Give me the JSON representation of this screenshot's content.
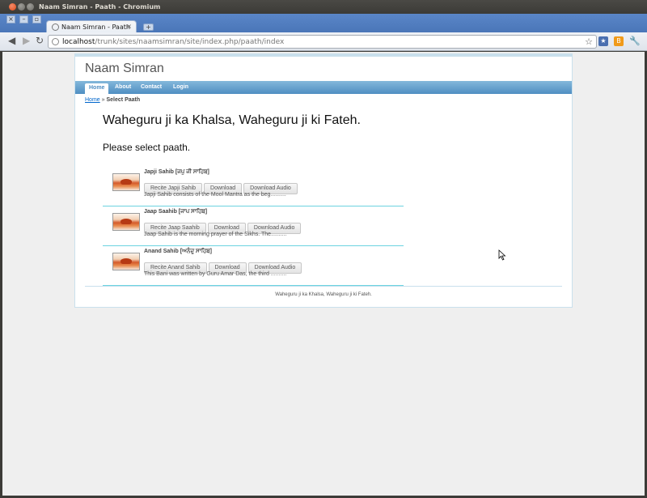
{
  "window": {
    "title": "Naam Simran - Paath - Chromium"
  },
  "tabs": [
    {
      "label": "Naam Simran - Paath",
      "close": "×"
    }
  ],
  "newtab_label": "+",
  "toolbar": {
    "url_host": "localhost",
    "url_path": "/trunk/sites/naamsimran/site/index.php/paath/index",
    "ext_icons": [
      "bookmark-star-icon",
      "blogger-icon",
      "wrench-icon"
    ]
  },
  "site": {
    "title": "Naam Simran",
    "menu": [
      "Home",
      "About",
      "Contact",
      "Login"
    ],
    "active_menu": "Home",
    "breadcrumb": {
      "home": "Home",
      "separator": "»",
      "current": "Select Paath"
    },
    "greeting": "Waheguru ji ka Khalsa, Waheguru ji ki Fateh.",
    "prompt": "Please select paath.",
    "paaths": [
      {
        "title": "Japji Sahib [ਜਪੁ ਜੀ ਸਾਹਿਬ]",
        "recite": "Recite Japji Sahib",
        "download": "Download",
        "download_audio": "Download Audio",
        "desc": "Japji Sahib consists of the Mool Mantra as the beg.........."
      },
      {
        "title": "Jaap Saahib [ਜਾਪ ਸਾਹਿਬ]",
        "recite": "Recite Jaap Saahib",
        "download": "Download",
        "download_audio": "Download Audio",
        "desc": "Jaap Sahib is the morning prayer of the Sikhs. The.........."
      },
      {
        "title": "Anand Sahib [ਅਨੰਦੁ ਸਾਹਿਬ]",
        "recite": "Recite Anand Sahib",
        "download": "Download",
        "download_audio": "Download Audio",
        "desc": "This Bani was written by Guru Amar Das, the third .........."
      }
    ],
    "footer": "Waheguru ji ka Khalsa, Waheguru ji ki Fateh."
  },
  "colors": {
    "menu": "#4f8ec2",
    "link": "#0066cc",
    "divider": "#6cd3e0",
    "chrome_tab_bg": "#5a86c8"
  }
}
